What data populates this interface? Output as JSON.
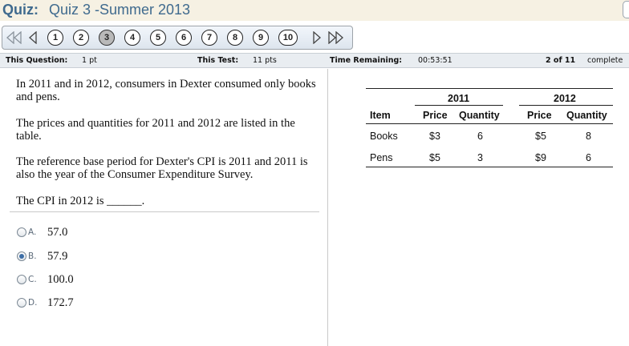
{
  "header": {
    "quiz_label": "Quiz:",
    "quiz_name": "Quiz 3 -Summer 2013"
  },
  "nav": {
    "questions": [
      "1",
      "2",
      "3",
      "4",
      "5",
      "6",
      "7",
      "8",
      "9",
      "10"
    ],
    "current_question": "3"
  },
  "info": {
    "question_label": "This Question:",
    "question_value": "1 pt",
    "test_label": "This Test:",
    "test_value": "11 pts",
    "time_label": "Time Remaining:",
    "time_value": "00:53:51",
    "progress_count": "2 of 11",
    "progress_label": "complete"
  },
  "question": {
    "paragraphs": [
      "In 2011 and in 2012, consumers in Dexter consumed only books and pens.",
      "The prices and quantities for 2011 and 2012 are listed in the table.",
      "The reference base period for Dexter's CPI is 2011 and 2011 is also the year of the Consumer Expenditure Survey.",
      "The CPI in 2012 is ______."
    ],
    "options": [
      {
        "letter": "A.",
        "value": "57.0",
        "selected": false
      },
      {
        "letter": "B.",
        "value": "57.9",
        "selected": true
      },
      {
        "letter": "C.",
        "value": "100.0",
        "selected": false
      },
      {
        "letter": "D.",
        "value": "172.7",
        "selected": false
      }
    ]
  },
  "table": {
    "years": [
      "2011",
      "2012"
    ],
    "headers": [
      "Item",
      "Price",
      "Quantity",
      "Price",
      "Quantity"
    ],
    "rows": [
      [
        "Books",
        "$3",
        "6",
        "$5",
        "8"
      ],
      [
        "Pens",
        "$5",
        "3",
        "$9",
        "6"
      ]
    ]
  },
  "colors": {
    "title_text": "#3f6a8e",
    "title_bar": "#f6f1e3",
    "info_bar": "#e9edf1",
    "radio_selected": "#3d6ea6"
  }
}
